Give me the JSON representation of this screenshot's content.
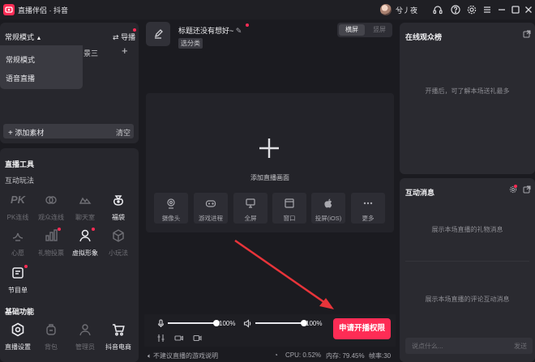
{
  "titlebar": {
    "app_title": "直播伴侣 · 抖音",
    "user_name": "兮丿夜"
  },
  "left_top": {
    "mode": "常规模式",
    "guide": "导播",
    "scene_tab_partial": "景三",
    "mode_options": [
      "常规模式",
      "语音直播"
    ],
    "add_material": "添加素材",
    "clear": "清空"
  },
  "tools": {
    "section_title": "直播工具",
    "interact_title": "互动玩法",
    "items": [
      {
        "label": "PK连线",
        "icon": "pk-icon"
      },
      {
        "label": "观众连线",
        "icon": "link-icon"
      },
      {
        "label": "聊天室",
        "icon": "chat-room-icon"
      },
      {
        "label": "福袋",
        "icon": "lucky-bag-icon"
      },
      {
        "label": "心愿",
        "icon": "wish-icon"
      },
      {
        "label": "礼物投票",
        "icon": "gift-vote-icon"
      },
      {
        "label": "虚拟形象",
        "icon": "avatar-icon"
      },
      {
        "label": "小玩法",
        "icon": "mini-game-icon"
      },
      {
        "label": "节目单",
        "icon": "program-list-icon"
      }
    ],
    "basic_title": "基础功能",
    "basic_items": [
      {
        "label": "直播设置",
        "icon": "settings-icon"
      },
      {
        "label": "背包",
        "icon": "backpack-icon"
      },
      {
        "label": "管理员",
        "icon": "admin-icon"
      },
      {
        "label": "抖音电商",
        "icon": "cart-icon"
      }
    ]
  },
  "stream": {
    "title": "标题还没有想好~",
    "category": "选分类",
    "orient_h": "横屏",
    "orient_v": "竖屏"
  },
  "preview": {
    "add_label": "添加直播画面",
    "sources": [
      {
        "label": "摄像头",
        "icon": "camera-icon"
      },
      {
        "label": "游戏进程",
        "icon": "gamepad-icon"
      },
      {
        "label": "全屏",
        "icon": "monitor-icon"
      },
      {
        "label": "窗口",
        "icon": "window-icon"
      },
      {
        "label": "投屏(iOS)",
        "icon": "apple-icon"
      },
      {
        "label": "更多",
        "icon": "more-icon"
      }
    ]
  },
  "audio": {
    "mic_volume": "100%",
    "speaker_volume": "100%",
    "mic_level": 1.0,
    "speaker_level": 1.0
  },
  "apply_button": "申请开播权限",
  "status": {
    "game_hint": "不建议直播的游戏说明",
    "cpu": "CPU: 0.52%",
    "memory": "内存: 79.45%",
    "fps": "帧率:30"
  },
  "viewers": {
    "title": "在线观众榜",
    "empty": "开播后，可了解本场送礼最多"
  },
  "interaction": {
    "title": "互动消息",
    "gift_empty": "展示本场直播的礼物消息",
    "comment_empty": "展示本场直播的评论互动消息",
    "input_placeholder": "说点什么...",
    "send": "发送"
  },
  "colors": {
    "accent": "#fe2c55",
    "background": "#1b1b20",
    "panel": "#27272d"
  }
}
